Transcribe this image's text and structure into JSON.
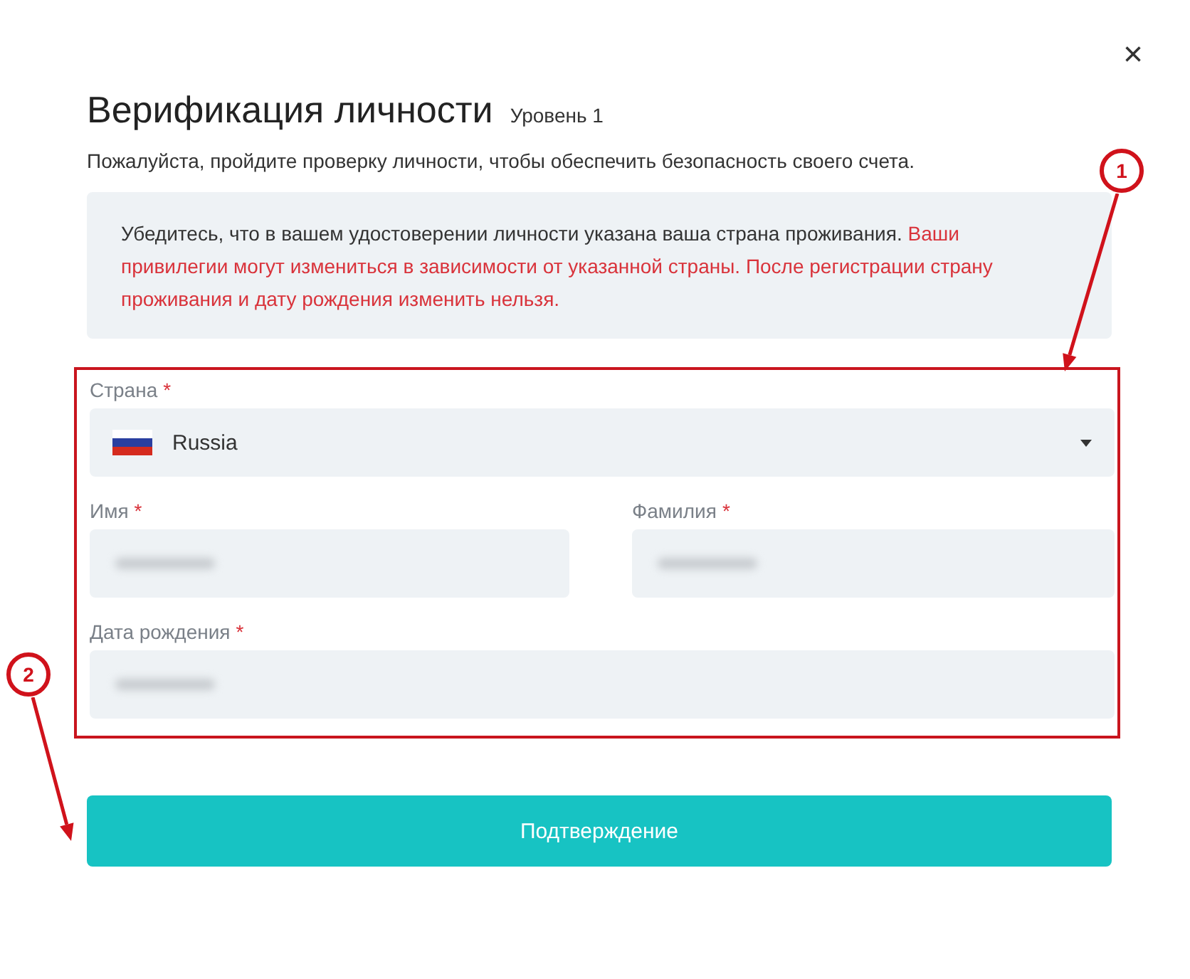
{
  "dialog": {
    "close": "×",
    "title": "Верификация личности",
    "level": "Уровень 1",
    "subtitle": "Пожалуйста, пройдите проверку личности, чтобы обеспечить безопасность своего счета."
  },
  "notice": {
    "text": "Убедитесь, что в вашем удостоверении личности указана ваша страна проживания.",
    "warning": "Ваши привилегии могут измениться в зависимости от указанной страны. После регистрации страну проживания и дату рождения изменить нельзя."
  },
  "form": {
    "highlighted": true,
    "rows": [
      [
        {
          "kind": "select",
          "label": "Страна",
          "marker": "*",
          "value": "Russia"
        }
      ],
      [
        {
          "kind": "text",
          "label": "Имя",
          "marker": "*",
          "blurred": true
        },
        {
          "kind": "text",
          "label": "Фамилия",
          "marker": "*",
          "blurred": true
        }
      ],
      [
        {
          "kind": "text",
          "label": "Дата рождения",
          "marker": "*",
          "blurred": true
        }
      ]
    ]
  },
  "submit": {
    "label": "Подтверждение"
  },
  "annotations": [
    {
      "label": "1"
    },
    {
      "label": "2"
    }
  ]
}
